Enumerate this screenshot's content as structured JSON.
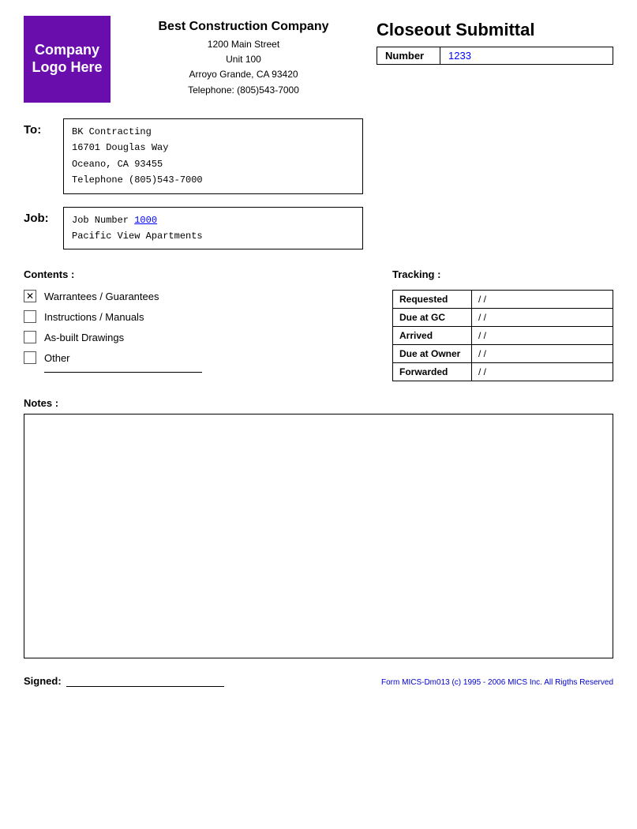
{
  "logo": {
    "text": "Company Logo Here"
  },
  "company": {
    "name": "Best Construction Company",
    "address1": "1200 Main Street",
    "address2": "Unit 100",
    "address3": "Arroyo Grande, CA 93420",
    "telephone": "Telephone: (805)543-7000"
  },
  "closeout": {
    "title": "Closeout Submittal",
    "number_label": "Number",
    "number_value": "1233"
  },
  "to": {
    "label": "To:",
    "line1": "BK Contracting",
    "line2": "16701 Douglas Way",
    "line3": "Oceano, CA 93455",
    "line4": "Telephone (805)543-7000"
  },
  "job": {
    "label": "Job:",
    "job_number_text": "Job Number ",
    "job_number_link": "1000",
    "job_name": "Pacific View Apartments"
  },
  "contents": {
    "label": "Contents :",
    "items": [
      {
        "id": "warranties",
        "label": "Warrantees / Guarantees",
        "checked": true
      },
      {
        "id": "instructions",
        "label": "Instructions / Manuals",
        "checked": false
      },
      {
        "id": "asbuilt",
        "label": "As-built Drawings",
        "checked": false
      },
      {
        "id": "other",
        "label": "Other",
        "checked": false
      }
    ]
  },
  "tracking": {
    "label": "Tracking :",
    "rows": [
      {
        "label": "Requested",
        "value": "/ /"
      },
      {
        "label": "Due at GC",
        "value": "/ /"
      },
      {
        "label": "Arrived",
        "value": "/ /"
      },
      {
        "label": "Due at Owner",
        "value": "/ /"
      },
      {
        "label": "Forwarded",
        "value": "/ /"
      }
    ]
  },
  "notes": {
    "label": "Notes :"
  },
  "footer": {
    "signed_label": "Signed:",
    "copyright": "Form MICS-Dm013 (c) 1995 - 2006 MICS Inc. All Rigths Reserved"
  }
}
